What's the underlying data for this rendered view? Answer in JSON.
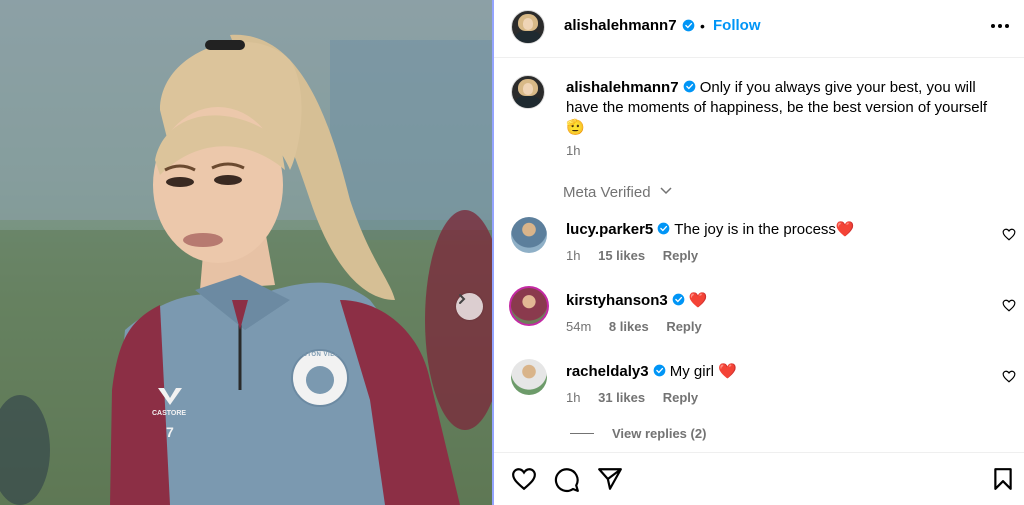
{
  "post": {
    "author": "alishalehmann7",
    "follow_label": "Follow",
    "separator": "•",
    "caption": "Only if you always give your best, you will have the moments of happiness, be the best version of yourself 🫡",
    "time": "1h",
    "meta_verified": "Meta Verified"
  },
  "comments": [
    {
      "username": "lucy.parker5",
      "text": "The joy is in the process❤️",
      "time": "1h",
      "likes": "15 likes",
      "reply": "Reply"
    },
    {
      "username": "kirstyhanson3",
      "text": "❤️",
      "time": "54m",
      "likes": "8 likes",
      "reply": "Reply"
    },
    {
      "username": "racheldaly3",
      "text": "My girl ❤️",
      "time": "1h",
      "likes": "31 likes",
      "reply": "Reply"
    }
  ],
  "view_replies": "View replies (2)",
  "photo": {
    "crest_text": "ASTON VILLA",
    "kit_brand": "CASTORE",
    "shirt_number": "7"
  },
  "icons": {
    "verified": "verified-badge-icon",
    "more": "more-options-icon",
    "like": "heart-icon",
    "comment": "comment-icon",
    "share": "paper-plane-icon",
    "save": "bookmark-icon",
    "next": "chevron-right-icon"
  },
  "colors": {
    "accent": "#0095f6",
    "secondary_text": "#737373",
    "shirt_blue": "#7b99b0",
    "shirt_claret": "#8c2f45"
  }
}
